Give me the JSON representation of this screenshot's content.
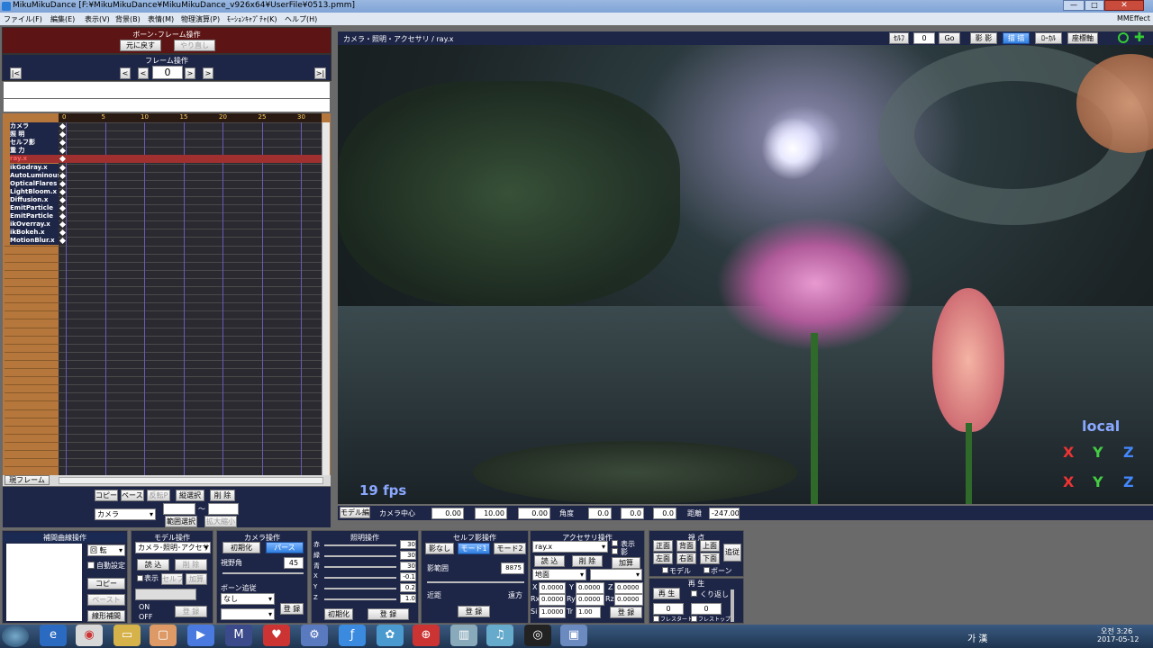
{
  "window": {
    "title": "MikuMikuDance [F:¥MikuMikuDance¥MikuMikuDance_v926x64¥UserFile¥0513.pmm]",
    "mmeffect": "MMEffect"
  },
  "menu": [
    "ファイル(F)",
    "編集(E)",
    "表示(V)",
    "背景(B)",
    "表情(M)",
    "物理演算(P)",
    "ﾓｰｼｮﾝｷｬﾌﾟﾁｬ(K)",
    "ヘルプ(H)"
  ],
  "bone": {
    "title": "ボーン･フレーム操作",
    "undo": "元に戻す",
    "redo": "やり直し",
    "frame_title": "フレーム操作",
    "frame": "0",
    "first": "|<",
    "prev10": "<",
    "prev": "<",
    "next": ">",
    "next10": ">",
    "last": ">|"
  },
  "timeline": {
    "ticks": [
      "0",
      "5",
      "10",
      "15",
      "20",
      "25",
      "30"
    ],
    "tracks": [
      "カメラ",
      "照 明",
      "セルフ影",
      "重 力",
      "ray.x",
      "ikGodray.x",
      "AutoLuminous",
      "OpticalFlares",
      "LightBloom.x",
      "Diffusion.x",
      "EmitParticle",
      "EmitParticle",
      "ikOverray.x",
      "ikBokeh.x",
      "MotionBlur.x"
    ],
    "current_frame_btn": "現フレーム"
  },
  "edit": {
    "copy": "コピー",
    "paste": "ペースト",
    "reverse": "反転P",
    "select_all": "縦選択",
    "delete": "削 除",
    "target": "カメラ",
    "range_select": "範囲選択",
    "expand": "拡大縮小",
    "range_to": "～"
  },
  "viewport": {
    "title": "カメラ・照明・アクセサリ / ray.x",
    "sel_label": "ｾﾙﾌ",
    "sel_val": "0",
    "go": "Go",
    "shadow": "影 影",
    "toggle": "描 描",
    "local_btn": "ﾛｰｶﾙ",
    "mode_btn": "座標軸",
    "fps": "19 fps",
    "local": "local",
    "axes": [
      "X",
      "Y",
      "Z"
    ]
  },
  "camera_bar": {
    "model_edit": "モデル編",
    "center": "カメラ中心",
    "cx": "0.00",
    "cy": "10.00",
    "cz": "0.00",
    "angle": "角度",
    "ax": "0.0",
    "ay": "0.0",
    "az": "0.0",
    "dist": "距離",
    "dval": "-247.00"
  },
  "interp": {
    "title": "補間曲線操作",
    "rotate": "回 転",
    "auto": "自動設定",
    "copy": "コピー",
    "paste": "ペースト",
    "linear": "線形補間"
  },
  "model": {
    "title": "モデル操作",
    "select": "カメラ･照明･アクセサリ",
    "load": "読 込",
    "delete": "削 除",
    "show": "表示",
    "self_shadow": "セルフ影",
    "add": "加算",
    "on": "ON",
    "off": "OFF",
    "register": "登 録"
  },
  "camera": {
    "title": "カメラ操作",
    "init": "初期化",
    "perspective": "パース",
    "fov_label": "視野角",
    "fov": "45",
    "bone_follow": "ボーン追従",
    "none": "なし",
    "register": "登 録"
  },
  "light": {
    "title": "照明操作",
    "labels": [
      "赤",
      "緑",
      "青",
      "X",
      "Y",
      "Z"
    ],
    "values": [
      "30",
      "30",
      "30",
      "-0.1",
      "0.2",
      "1.0"
    ],
    "init": "初期化",
    "register": "登 録"
  },
  "selfshadow": {
    "title": "セルフ影操作",
    "none": "影なし",
    "mode1": "モード1",
    "mode2": "モード2",
    "range_label": "影範囲",
    "range": "8875",
    "near": "近距",
    "far": "遠方",
    "register": "登 録"
  },
  "accessory": {
    "title": "アクセサリ操作",
    "name": "ray.x",
    "show": "表示",
    "shadow": "影",
    "load": "読 込",
    "delete": "削 除",
    "add": "加算",
    "ground": "地面",
    "x": "0.0000",
    "y": "0.0000",
    "z": "0.0000",
    "rx": "0.0000",
    "ry": "0.0000",
    "rz": "0.0000",
    "si": "1.0000",
    "tr": "1.00",
    "register": "登 録"
  },
  "view": {
    "title": "視 点",
    "front": "正面",
    "back": "背面",
    "top": "上面",
    "left": "左面",
    "right": "右面",
    "bottom": "下面",
    "track": "追従",
    "model": "モデル",
    "bone": "ボーン"
  },
  "play": {
    "title": "再 生",
    "play": "再 生",
    "repeat": "くり返し",
    "from": "0",
    "to": "0",
    "frame_start": "フレスタート",
    "frame_stop": "フレストップ"
  },
  "taskbar": {
    "ime": "가 漢",
    "time": "오전 3:26",
    "date": "2017-05-12"
  }
}
